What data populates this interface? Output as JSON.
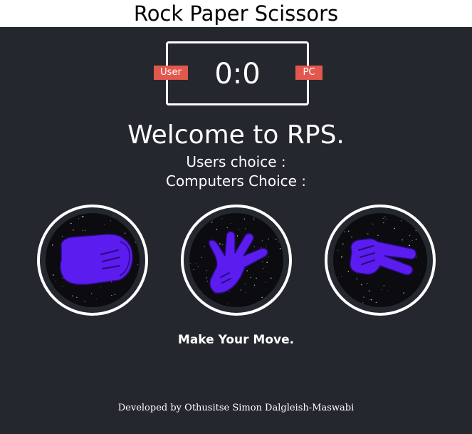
{
  "header": {
    "title": "Rock Paper Scissors"
  },
  "scoreboard": {
    "user_label": "User",
    "pc_label": "PC",
    "score": "0:0"
  },
  "messages": {
    "welcome": "Welcome to RPS.",
    "users_choice": "Users choice :",
    "computers_choice": "Computers Choice :",
    "prompt": "Make Your Move."
  },
  "choices": [
    {
      "name": "rock",
      "icon": "fist-icon"
    },
    {
      "name": "paper",
      "icon": "open-hand-icon"
    },
    {
      "name": "scissors",
      "icon": "scissors-hand-icon"
    }
  ],
  "footer": {
    "credit": "Developed by Othusitse Simon Dalgleish-Maswabi"
  },
  "colors": {
    "background": "#24272e",
    "badge": "#e2584d",
    "hand": "#5b1cf0",
    "header_bg": "#ffffff"
  }
}
